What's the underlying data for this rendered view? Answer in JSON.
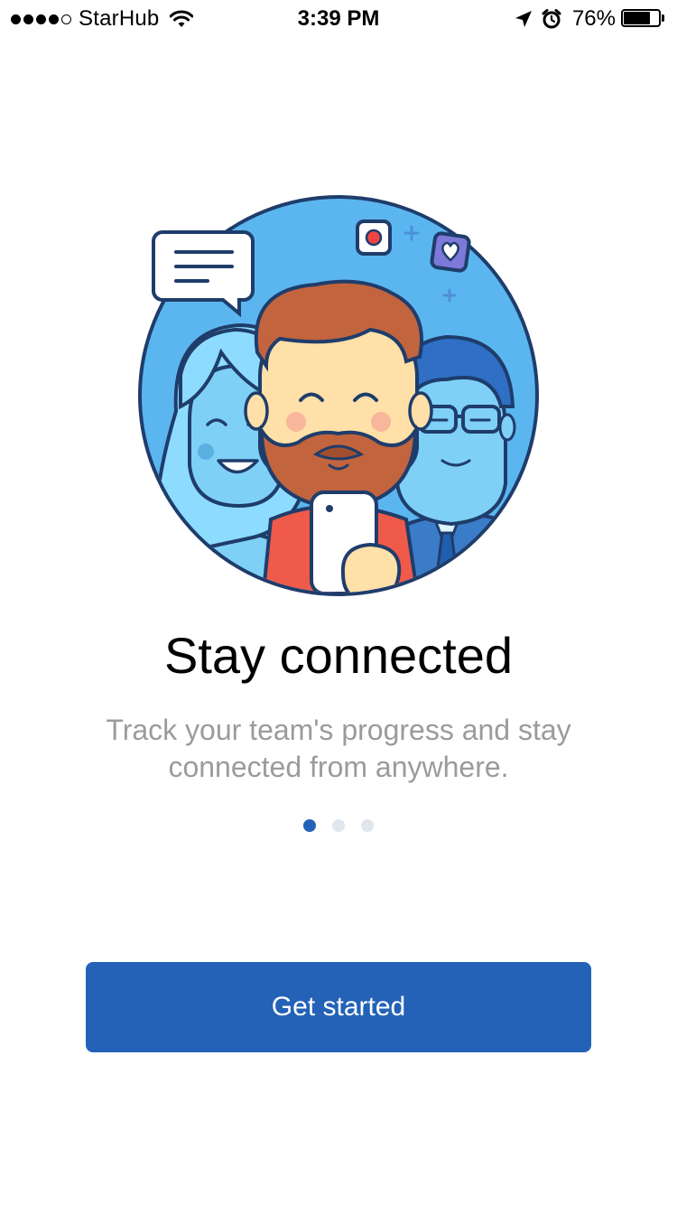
{
  "status_bar": {
    "carrier": "StarHub",
    "time": "3:39 PM",
    "battery_percent": "76%",
    "battery_level": 0.76,
    "signal_bars": [
      true,
      true,
      true,
      true,
      false
    ],
    "icons": [
      "wifi-icon",
      "location-arrow-icon",
      "alarm-clock-icon",
      "battery-icon"
    ]
  },
  "onboarding": {
    "illustration": "team-selfie-illustration",
    "title": "Stay connected",
    "subtitle": "Track your team's progress and stay connected from anywhere.",
    "pager": {
      "total": 3,
      "active_index": 0
    },
    "cta_label": "Get started"
  },
  "colors": {
    "primary": "#2462B8",
    "subtitle_text": "#9B9B9B",
    "pager_inactive": "#DFE6EE",
    "circle_bg": "#5BB6EF"
  }
}
